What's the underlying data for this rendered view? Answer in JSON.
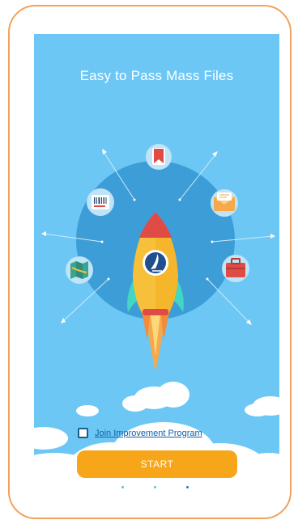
{
  "screen": {
    "title": "Easy to Pass Mass Files"
  },
  "improvement": {
    "label": "Join Improvement Program",
    "checked": false
  },
  "actions": {
    "start_label": "START"
  },
  "pager": {
    "pages": 3,
    "active_index": 2
  },
  "icons": [
    "bookmark-icon",
    "envelope-icon",
    "briefcase-icon",
    "barcode-icon",
    "map-icon",
    "rocket-icon"
  ],
  "colors": {
    "frame_border": "#F2A25A",
    "background": "#6CC7F5",
    "circle": "#3D9DD7",
    "button": "#F7A61A",
    "link": "#0E5FA8"
  }
}
